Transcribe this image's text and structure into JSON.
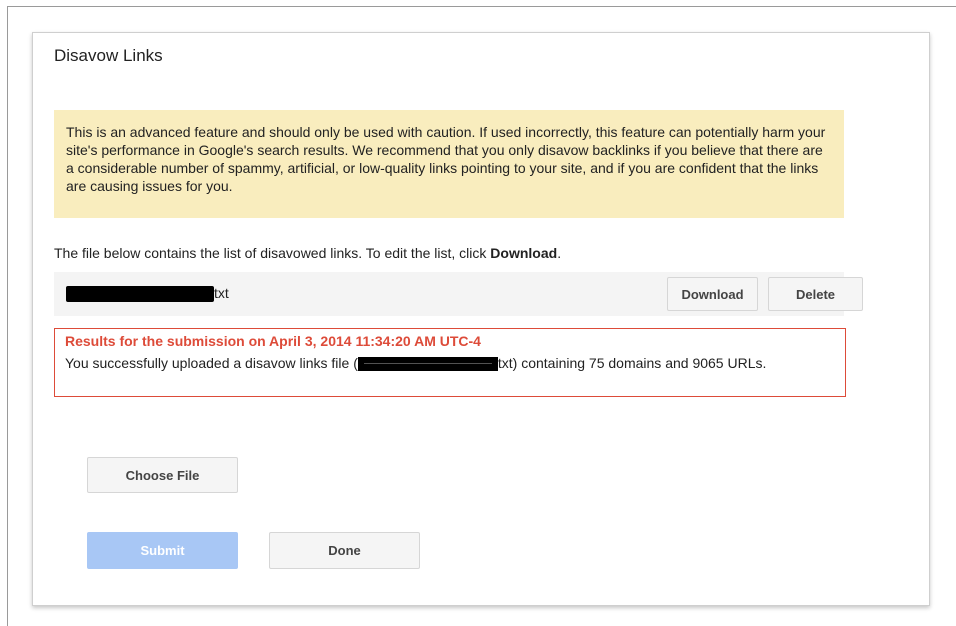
{
  "dialog": {
    "title": "Disavow Links",
    "warning_text": "This is an advanced feature and should only be used with caution. If used incorrectly, this feature can potentially harm your site's performance in Google's search results. We recommend that you only disavow backlinks if you believe that there are a considerable number of spammy, artificial, or low-quality links pointing to your site, and if you are confident that the links are causing issues for you.",
    "info_prefix": "The file below contains the list of disavowed links. To edit the list, click ",
    "info_bold": "Download",
    "info_suffix": ".",
    "file": {
      "ext_text": "txt",
      "download_label": "Download",
      "delete_label": "Delete"
    },
    "results": {
      "title": "Results for the submission on April 3, 2014 11:34:20 AM UTC-4",
      "body_prefix": "You successfully uploaded a disavow links file (",
      "body_suffix": "txt) containing 75 domains and 9065 URLs."
    },
    "choose_file_label": "Choose File",
    "submit_label": "Submit",
    "done_label": "Done"
  },
  "colors": {
    "warning_bg": "#f9edbe",
    "error_red": "#dd4b39",
    "submit_disabled": "#a8c7f5"
  }
}
